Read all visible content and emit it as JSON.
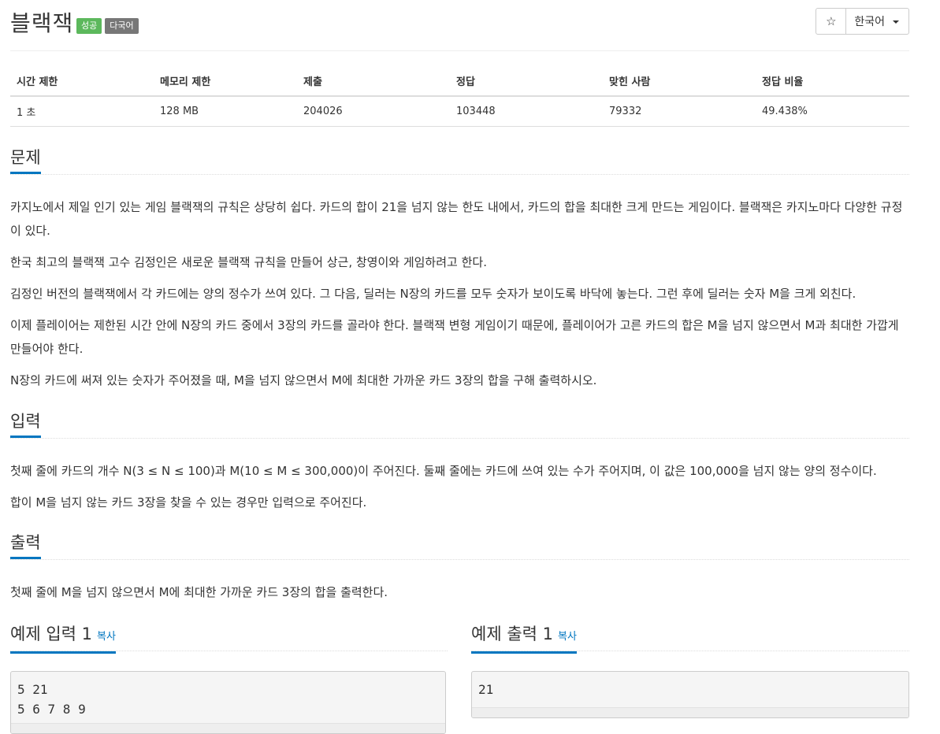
{
  "problem": {
    "title": "블랙잭",
    "labels": {
      "success": "성공",
      "multi": "다국어"
    },
    "star_glyph": "☆",
    "language": "한국어"
  },
  "info": {
    "headers": [
      "시간 제한",
      "메모리 제한",
      "제출",
      "정답",
      "맞힌 사람",
      "정답 비율"
    ],
    "values": [
      "1 초",
      "128 MB",
      "204026",
      "103448",
      "79332",
      "49.438%"
    ]
  },
  "sections": {
    "problem": {
      "title": "문제",
      "paragraphs": [
        "카지노에서 제일 인기 있는 게임 블랙잭의 규칙은 상당히 쉽다. 카드의 합이 21을 넘지 않는 한도 내에서, 카드의 합을 최대한 크게 만드는 게임이다. 블랙잭은 카지노마다 다양한 규정이 있다.",
        "한국 최고의 블랙잭 고수 김정인은 새로운 블랙잭 규칙을 만들어 상근, 창영이와 게임하려고 한다.",
        "김정인 버전의 블랙잭에서 각 카드에는 양의 정수가 쓰여 있다. 그 다음, 딜러는 N장의 카드를 모두 숫자가 보이도록 바닥에 놓는다. 그런 후에 딜러는 숫자 M을 크게 외친다.",
        "이제 플레이어는 제한된 시간 안에 N장의 카드 중에서 3장의 카드를 골라야 한다. 블랙잭 변형 게임이기 때문에, 플레이어가 고른 카드의 합은 M을 넘지 않으면서 M과 최대한 가깝게 만들어야 한다.",
        "N장의 카드에 써져 있는 숫자가 주어졌을 때, M을 넘지 않으면서 M에 최대한 가까운 카드 3장의 합을 구해 출력하시오."
      ]
    },
    "input": {
      "title": "입력",
      "paragraphs": [
        "첫째 줄에 카드의 개수 N(3 ≤ N ≤ 100)과 M(10 ≤ M ≤ 300,000)이 주어진다. 둘째 줄에는 카드에 쓰여 있는 수가 주어지며, 이 값은 100,000을 넘지 않는 양의 정수이다.",
        "합이 M을 넘지 않는 카드 3장을 찾을 수 있는 경우만 입력으로 주어진다."
      ]
    },
    "output": {
      "title": "출력",
      "paragraphs": [
        "첫째 줄에 M을 넘지 않으면서 M에 최대한 가까운 카드 3장의 합을 출력한다."
      ]
    }
  },
  "samples": {
    "input": {
      "title": "예제 입력 1",
      "copy_label": "복사",
      "lines": [
        "5 21",
        "5 6 7 8 9"
      ]
    },
    "output": {
      "title": "예제 출력 1",
      "copy_label": "복사",
      "lines": [
        "21"
      ]
    }
  }
}
